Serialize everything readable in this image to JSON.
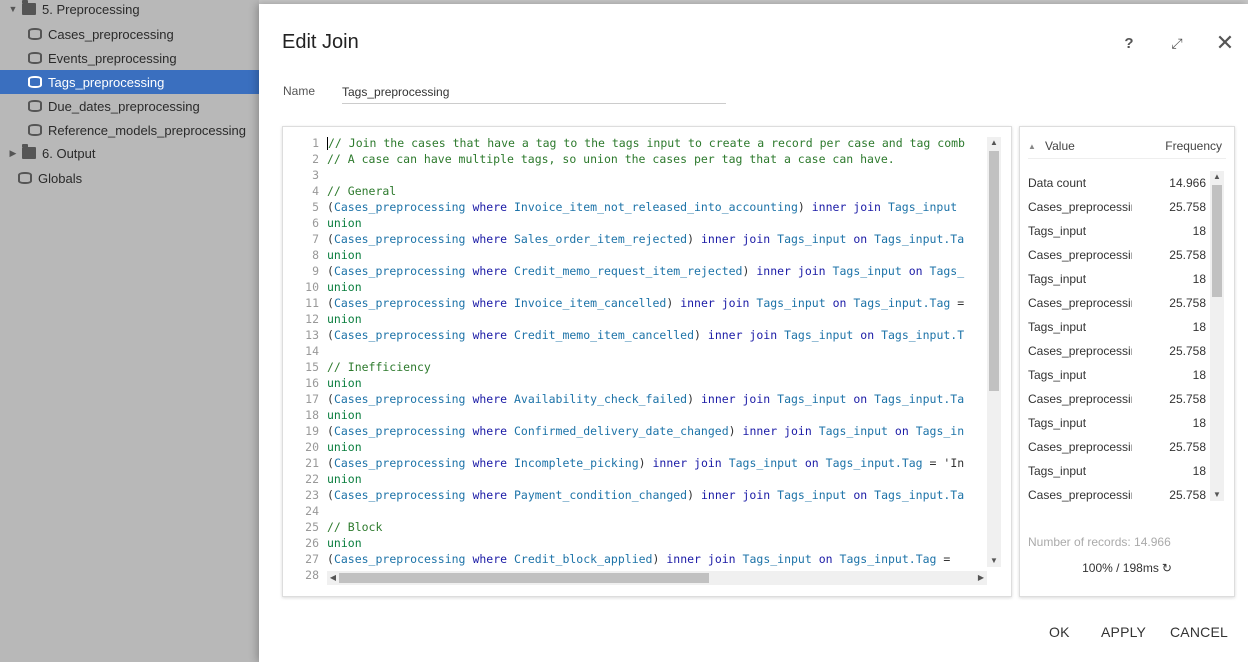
{
  "tree": {
    "items": [
      {
        "label": "5. Preprocessing",
        "type": "folder",
        "expanded": true
      },
      {
        "label": "Cases_preprocessing",
        "type": "table"
      },
      {
        "label": "Events_preprocessing",
        "type": "table"
      },
      {
        "label": "Tags_preprocessing",
        "type": "table",
        "selected": true
      },
      {
        "label": "Due_dates_preprocessing",
        "type": "table"
      },
      {
        "label": "Reference_models_preprocessing",
        "type": "table"
      },
      {
        "label": "6. Output",
        "type": "folder",
        "expanded": false
      },
      {
        "label": "Globals",
        "type": "globals"
      }
    ]
  },
  "modal": {
    "title": "Edit Join",
    "help_icon": "help-icon",
    "expand_icon": "expand-icon",
    "close_icon": "close-icon",
    "name_label": "Name",
    "name_value": "Tags_preprocessing"
  },
  "editor": {
    "lines": [
      {
        "n": "1",
        "html": "<span class=\"cursor\"></span><span class=\"t-cmt\">// Join the cases that have a tag to the tags input to create a record per case and tag comb</span>"
      },
      {
        "n": "2",
        "html": "<span class=\"t-cmt\">// A case can have multiple tags, so union the cases per tag that a case can have.</span>"
      },
      {
        "n": "3",
        "html": ""
      },
      {
        "n": "4",
        "html": "<span class=\"t-cmt\">// General</span>"
      },
      {
        "n": "5",
        "html": "<span class=\"t-plain\">(</span><span class=\"t-ident\">Cases_preprocessing</span> <span class=\"t-kw\">where</span> <span class=\"t-ident\">Invoice_item_not_released_into_accounting</span><span class=\"t-plain\">)</span> <span class=\"t-kw\">inner join</span> <span class=\"t-ident\">Tags_input</span>"
      },
      {
        "n": "6",
        "html": "<span class=\"t-kw2\">union</span>"
      },
      {
        "n": "7",
        "html": "<span class=\"t-plain\">(</span><span class=\"t-ident\">Cases_preprocessing</span> <span class=\"t-kw\">where</span> <span class=\"t-ident\">Sales_order_item_rejected</span><span class=\"t-plain\">)</span> <span class=\"t-kw\">inner join</span> <span class=\"t-ident\">Tags_input</span> <span class=\"t-kw\">on</span> <span class=\"t-ident\">Tags_input.Ta</span>"
      },
      {
        "n": "8",
        "html": "<span class=\"t-kw2\">union</span>"
      },
      {
        "n": "9",
        "html": "<span class=\"t-plain\">(</span><span class=\"t-ident\">Cases_preprocessing</span> <span class=\"t-kw\">where</span> <span class=\"t-ident\">Credit_memo_request_item_rejected</span><span class=\"t-plain\">)</span> <span class=\"t-kw\">inner join</span> <span class=\"t-ident\">Tags_input</span> <span class=\"t-kw\">on</span> <span class=\"t-ident\">Tags_</span>"
      },
      {
        "n": "10",
        "html": "<span class=\"t-kw2\">union</span>"
      },
      {
        "n": "11",
        "html": "<span class=\"t-plain\">(</span><span class=\"t-ident\">Cases_preprocessing</span> <span class=\"t-kw\">where</span> <span class=\"t-ident\">Invoice_item_cancelled</span><span class=\"t-plain\">)</span> <span class=\"t-kw\">inner join</span> <span class=\"t-ident\">Tags_input</span> <span class=\"t-kw\">on</span> <span class=\"t-ident\">Tags_input.Tag</span> <span class=\"t-plain\">=</span>"
      },
      {
        "n": "12",
        "html": "<span class=\"t-kw2\">union</span>"
      },
      {
        "n": "13",
        "html": "<span class=\"t-plain\">(</span><span class=\"t-ident\">Cases_preprocessing</span> <span class=\"t-kw\">where</span> <span class=\"t-ident\">Credit_memo_item_cancelled</span><span class=\"t-plain\">)</span> <span class=\"t-kw\">inner join</span> <span class=\"t-ident\">Tags_input</span> <span class=\"t-kw\">on</span> <span class=\"t-ident\">Tags_input.T</span>"
      },
      {
        "n": "14",
        "html": ""
      },
      {
        "n": "15",
        "html": "<span class=\"t-cmt\">// Inefficiency</span>"
      },
      {
        "n": "16",
        "html": "<span class=\"t-kw2\">union</span>"
      },
      {
        "n": "17",
        "html": "<span class=\"t-plain\">(</span><span class=\"t-ident\">Cases_preprocessing</span> <span class=\"t-kw\">where</span> <span class=\"t-ident\">Availability_check_failed</span><span class=\"t-plain\">)</span> <span class=\"t-kw\">inner join</span> <span class=\"t-ident\">Tags_input</span> <span class=\"t-kw\">on</span> <span class=\"t-ident\">Tags_input.Ta</span>"
      },
      {
        "n": "18",
        "html": "<span class=\"t-kw2\">union</span>"
      },
      {
        "n": "19",
        "html": "<span class=\"t-plain\">(</span><span class=\"t-ident\">Cases_preprocessing</span> <span class=\"t-kw\">where</span> <span class=\"t-ident\">Confirmed_delivery_date_changed</span><span class=\"t-plain\">)</span> <span class=\"t-kw\">inner join</span> <span class=\"t-ident\">Tags_input</span> <span class=\"t-kw\">on</span> <span class=\"t-ident\">Tags_in</span>"
      },
      {
        "n": "20",
        "html": "<span class=\"t-kw2\">union</span>"
      },
      {
        "n": "21",
        "html": "<span class=\"t-plain\">(</span><span class=\"t-ident\">Cases_preprocessing</span> <span class=\"t-kw\">where</span> <span class=\"t-ident\">Incomplete_picking</span><span class=\"t-plain\">)</span> <span class=\"t-kw\">inner join</span> <span class=\"t-ident\">Tags_input</span> <span class=\"t-kw\">on</span> <span class=\"t-ident\">Tags_input.Tag</span> <span class=\"t-plain\">= 'In</span>"
      },
      {
        "n": "22",
        "html": "<span class=\"t-kw2\">union</span>"
      },
      {
        "n": "23",
        "html": "<span class=\"t-plain\">(</span><span class=\"t-ident\">Cases_preprocessing</span> <span class=\"t-kw\">where</span> <span class=\"t-ident\">Payment_condition_changed</span><span class=\"t-plain\">)</span> <span class=\"t-kw\">inner join</span> <span class=\"t-ident\">Tags_input</span> <span class=\"t-kw\">on</span> <span class=\"t-ident\">Tags_input.Ta</span>"
      },
      {
        "n": "24",
        "html": ""
      },
      {
        "n": "25",
        "html": "<span class=\"t-cmt\">// Block</span>"
      },
      {
        "n": "26",
        "html": "<span class=\"t-kw2\">union</span>"
      },
      {
        "n": "27",
        "html": "<span class=\"t-plain\">(</span><span class=\"t-ident\">Cases_preprocessing</span> <span class=\"t-kw\">where</span> <span class=\"t-ident\">Credit_block_applied</span><span class=\"t-plain\">)</span> <span class=\"t-kw\">inner join</span> <span class=\"t-ident\">Tags_input</span> <span class=\"t-kw\">on</span> <span class=\"t-ident\">Tags_input.Tag</span> <span class=\"t-plain\">=</span>"
      },
      {
        "n": "28",
        "html": ""
      }
    ]
  },
  "preview": {
    "col_value": "Value",
    "col_frequency": "Frequency",
    "rows": [
      {
        "value": "Data count",
        "freq": "14.966"
      },
      {
        "value": "Cases_preprocessing",
        "freq": "25.758"
      },
      {
        "value": "Tags_input",
        "freq": "18"
      },
      {
        "value": "Cases_preprocessing",
        "freq": "25.758"
      },
      {
        "value": "Tags_input",
        "freq": "18"
      },
      {
        "value": "Cases_preprocessing",
        "freq": "25.758"
      },
      {
        "value": "Tags_input",
        "freq": "18"
      },
      {
        "value": "Cases_preprocessing",
        "freq": "25.758"
      },
      {
        "value": "Tags_input",
        "freq": "18"
      },
      {
        "value": "Cases_preprocessing",
        "freq": "25.758"
      },
      {
        "value": "Tags_input",
        "freq": "18"
      },
      {
        "value": "Cases_preprocessing",
        "freq": "25.758"
      },
      {
        "value": "Tags_input",
        "freq": "18"
      },
      {
        "value": "Cases_preprocessing",
        "freq": "25.758"
      }
    ],
    "records_label": "Number of records: 14.966",
    "timing": "100% / 198ms",
    "refresh_icon": "refresh-icon"
  },
  "footer": {
    "ok_label": "OK",
    "apply_label": "APPLY",
    "cancel_label": "CANCEL"
  }
}
